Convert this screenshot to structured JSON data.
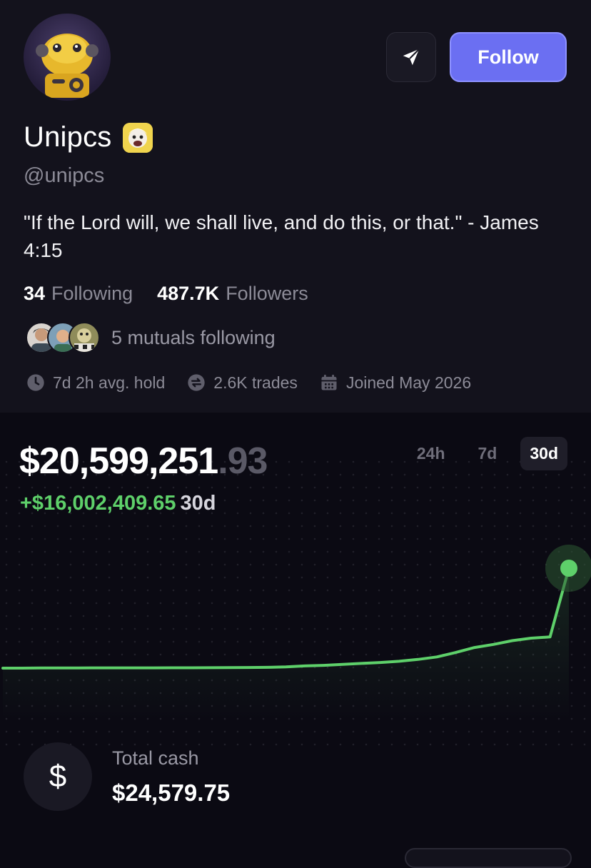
{
  "profile": {
    "name": "Unipcs",
    "handle": "@unipcs",
    "bio": "\"If the Lord will, we shall live, and do this, or that.\" - James 4:15",
    "follow_label": "Follow",
    "following_count": "34",
    "following_label": "Following",
    "followers_count": "487.7K",
    "followers_label": "Followers",
    "mutuals_text": "5 mutuals following",
    "avg_hold": "7d 2h avg. hold",
    "trades": "2.6K trades",
    "joined": "Joined May 2026"
  },
  "portfolio": {
    "balance_main": "$20,599,251",
    "balance_cents": ".93",
    "change_value": "+$16,002,409.65",
    "change_period": "30d",
    "ranges": [
      "24h",
      "7d",
      "30d"
    ],
    "active_range": "30d",
    "cash_label": "Total cash",
    "cash_value": "$24,579.75",
    "cash_symbol": "$"
  },
  "colors": {
    "accent": "#6b6ff2",
    "gain": "#5ed06a",
    "background": "#0b0a13",
    "card": "#13121c"
  },
  "chart_data": {
    "type": "line",
    "title": "",
    "x": [
      0,
      1,
      2,
      3,
      4,
      5,
      6,
      7,
      8,
      9,
      10,
      11,
      12,
      13,
      14,
      15,
      16,
      17,
      18,
      19,
      20,
      21,
      22,
      23,
      24,
      25,
      26,
      27,
      28,
      29,
      30
    ],
    "series": [
      {
        "values": [
          4.6,
          4.6,
          4.62,
          4.63,
          4.64,
          4.65,
          4.65,
          4.65,
          4.65,
          4.66,
          4.66,
          4.67,
          4.68,
          4.7,
          4.72,
          4.8,
          4.95,
          5.05,
          5.2,
          5.35,
          5.5,
          5.7,
          6.0,
          6.4,
          7.1,
          7.9,
          8.4,
          9.0,
          9.4,
          9.6,
          20.6
        ]
      }
    ],
    "y_unit": "$M",
    "grid": false
  }
}
